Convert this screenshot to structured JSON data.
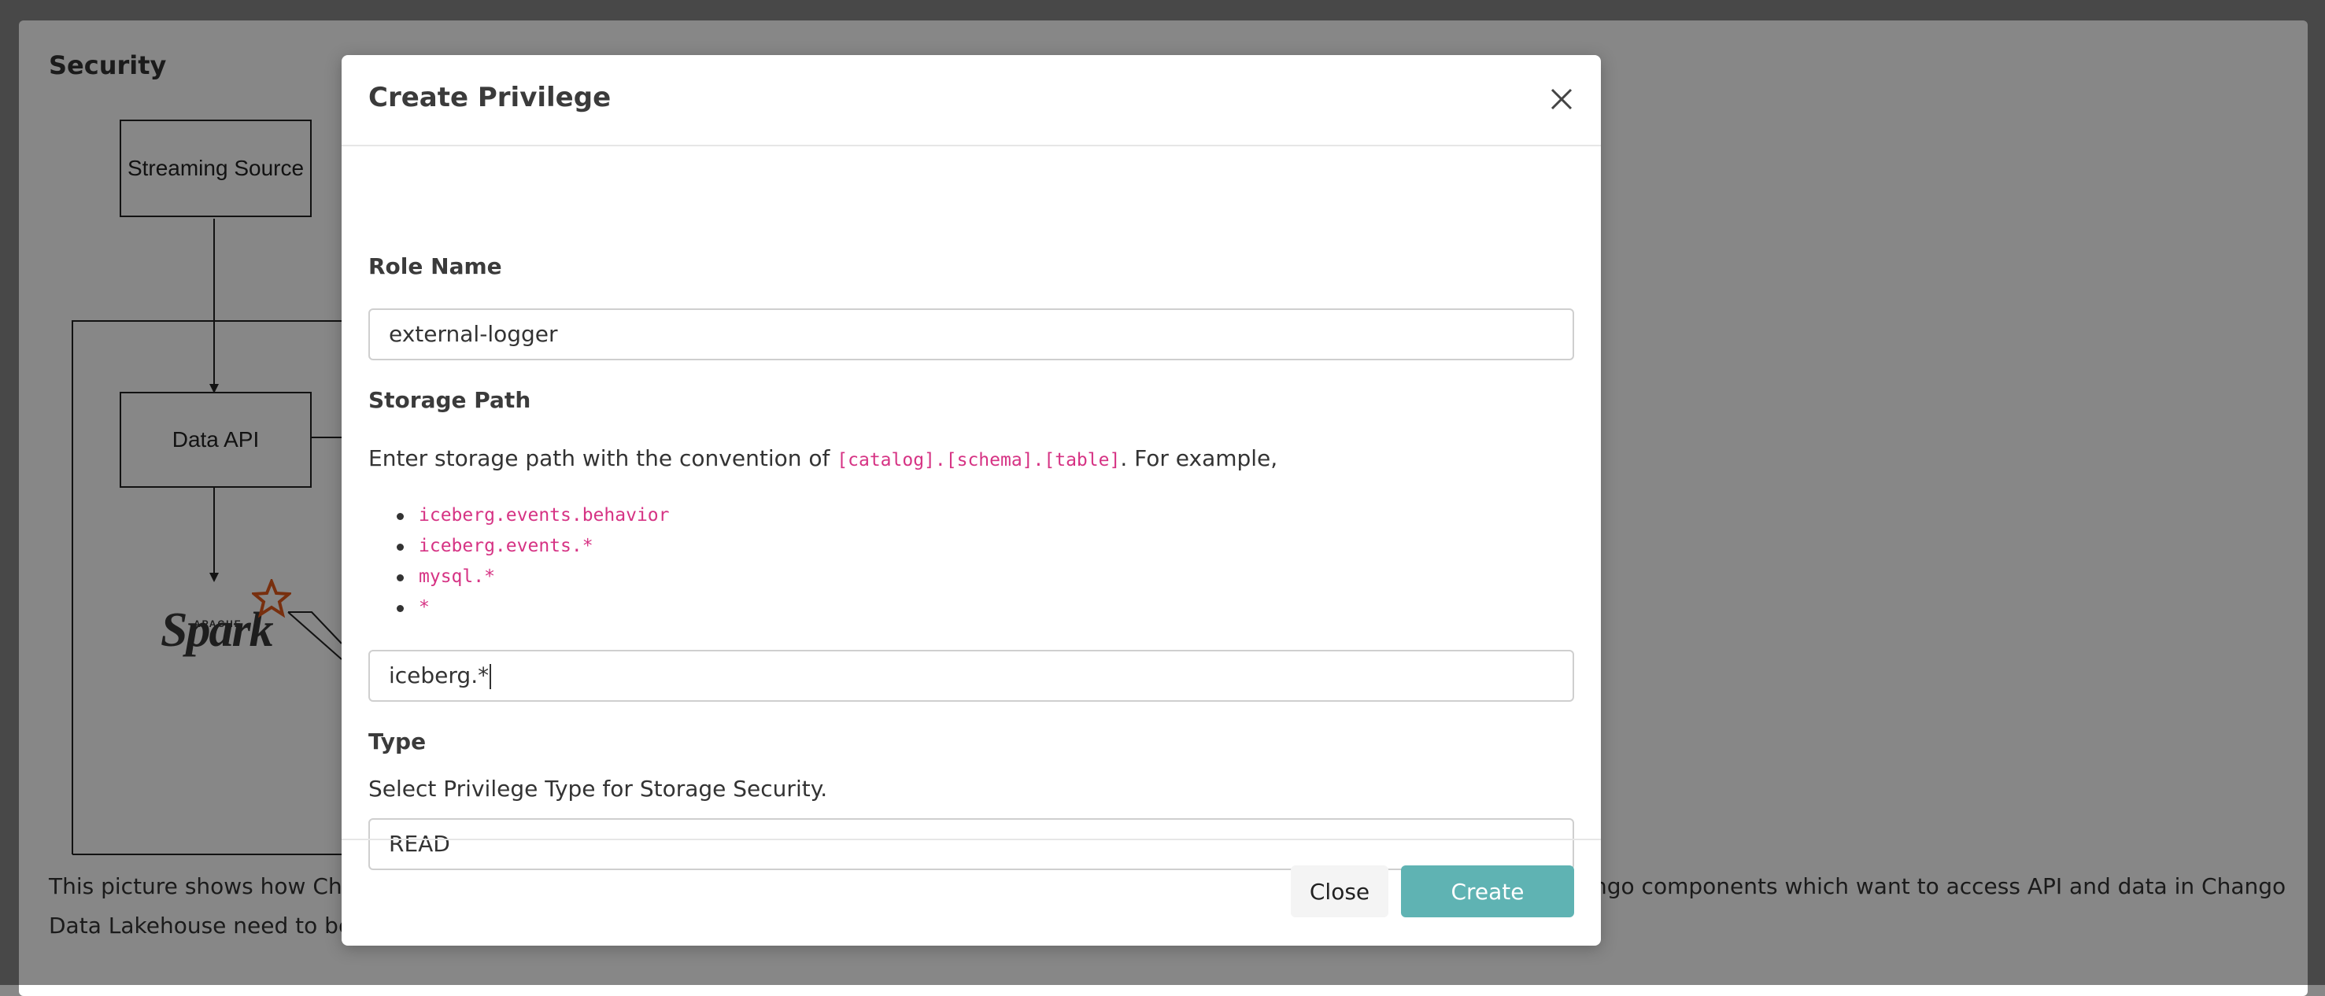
{
  "background": {
    "title": "Security",
    "diagram": {
      "streaming_source": "Streaming Source",
      "data_api": "Data API",
      "spark_logo": "Spark",
      "spark_apache": "APACHE"
    },
    "description_line1": "This picture shows how Chan",
    "description_line1_right": "ngo components which want to access API and data in Chango",
    "description_line2": "Data Lakehouse need to be a"
  },
  "modal": {
    "title": "Create Privilege",
    "role_name": {
      "label": "Role Name",
      "value": "external-logger"
    },
    "storage_path": {
      "label": "Storage Path",
      "help_prefix": "Enter storage path with the convention of ",
      "help_code": "[catalog].[schema].[table]",
      "help_suffix": ". For example,",
      "examples": [
        "iceberg.events.behavior",
        "iceberg.events.*",
        "mysql.*",
        "*"
      ],
      "value": "iceberg.*"
    },
    "type": {
      "label": "Type",
      "help": "Select Privilege Type for Storage Security.",
      "selected": "READ"
    },
    "buttons": {
      "close": "Close",
      "create": "Create"
    }
  },
  "colors": {
    "accent": "#5fb3b3",
    "code": "#d63384"
  }
}
